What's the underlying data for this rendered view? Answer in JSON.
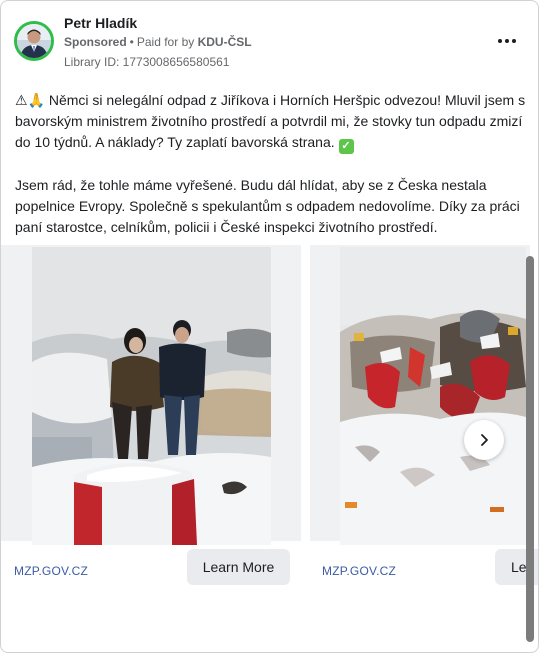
{
  "author": {
    "name": "Petr Hladík"
  },
  "meta": {
    "sponsored": "Sponsored",
    "separator": "•",
    "paid_prefix": "Paid for by",
    "payer": "KDU-ČSL",
    "library_id": "Library ID: 1773008656580561"
  },
  "menu": {
    "icon": "more-horizontal-icon"
  },
  "post": {
    "paragraph1_emoji": "⚠🙏",
    "paragraph1": " Němci si nelegální odpad z Jiříkova i Horních Heršpic odvezou! Mluvil jsem s bavorským ministrem životního prostředí a potvrdil mi, že stovky tun odpadu zmizí do 10 týdnů. A náklady? Ty zaplatí bavorská strana. ",
    "paragraph1_check": "✓",
    "paragraph2": "Jsem rád, že tohle máme vyřešené. Budu dál hlídat, aby se z Česka nestala popelnice Evropy. Společně s spekulantům s odpadem nedovolíme. Díky za práci paní starostce, celníkům, policii i České inspekci životního prostředí."
  },
  "carousel": {
    "cards": [
      {
        "domain": "MZP.GOV.CZ",
        "cta": "Learn More"
      },
      {
        "domain": "MZP.GOV.CZ",
        "cta": "Le"
      }
    ],
    "next_icon": "chevron-right-icon"
  }
}
